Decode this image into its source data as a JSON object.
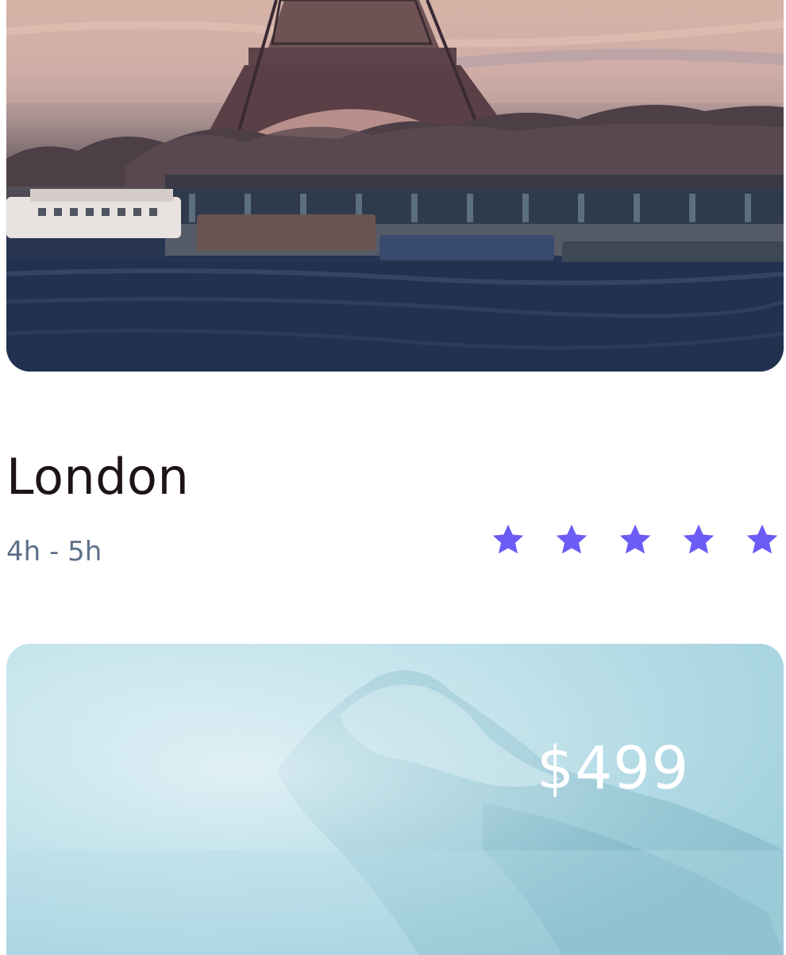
{
  "destinations": [
    {
      "image": "eiffel-tower-seine-photo",
      "city": "London",
      "duration": "4h - 5h",
      "rating": 5,
      "rating_max": 5
    },
    {
      "image": "snowy-mountain-mist-photo",
      "price": "$499"
    }
  ],
  "colors": {
    "star": "#6b5cf6",
    "title": "#1d1416",
    "subtitle": "#5b7087",
    "price": "#ffffff"
  }
}
